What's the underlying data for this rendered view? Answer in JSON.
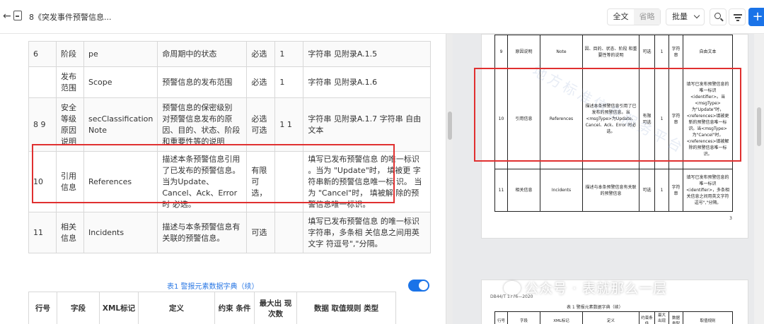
{
  "toolbar": {
    "back": "←",
    "doc_title": "8《突发事件预警信息...",
    "view_full": "全文",
    "view_brief": "省略",
    "batch": "批量",
    "add": "+"
  },
  "left_table": {
    "rows": [
      {
        "no": "6",
        "name": "阶段",
        "xml": "pe",
        "def": "命周期中的状态",
        "req": "必选",
        "count": "1",
        "type": "字符串 见附录A.1.5"
      },
      {
        "no": "",
        "name": "发布范围",
        "xml": "Scope",
        "def": "预警信息的发布范围",
        "req": "必选",
        "count": "1",
        "type": "字符串 见附录A.1.6"
      },
      {
        "no": "8 9",
        "name": "安全等级 原因说明",
        "xml": "secClassification Note",
        "def": "预警信息的保密级别 对预警信息发布的原 因、目的、状态、阶段 和重要性等的说明",
        "req": "必选 可选",
        "count": "1 1",
        "type": "字符串 见附录A.1.7 字符串 自由文本"
      },
      {
        "no": "10",
        "name": "引用信息",
        "xml": "References",
        "def": "描述本条预警信息引用了已发布的预警信息。当为Update、Cancel、Ack、Error 时 必选。",
        "req": "有限可选，",
        "count": "",
        "type": "填写已发布预警信息 的唯一标识 。当为 \"Update\"时， 填被更 字符串新的预警信息唯一标 识。 当为 \"Cancel\"时， 填被解 除的预警信息唯一标识。"
      },
      {
        "no": "11",
        "name": "相关信息",
        "xml": "Incidents",
        "def": "描述与本条预警信息有关联的预警信息。",
        "req": "可选",
        "count": "",
        "type": "填写已发布预警信息 的唯一标识 字符串，多条相 关信息之间用英文字 符逗号\",\"分隔。"
      }
    ],
    "caption": "表1 警报元素数据字典（续）",
    "header2": [
      "行号",
      "字段",
      "XML标记",
      "定义",
      "约束 条件",
      "最大出 现次数",
      "数据 取值规则 类型"
    ]
  },
  "right_page": {
    "watermark_text": "地方标准信息服务平台",
    "rows": [
      {
        "no": "9",
        "name": "原因说明",
        "xml": "Note",
        "def": "因、目的、状态、阶段 和重要性等的说明",
        "req": "可选",
        "count": "1",
        "dtype": "字符串",
        "rule": "自由文本"
      },
      {
        "no": "10",
        "name": "引用信息",
        "xml": "References",
        "def": "描述本条预警信息引用了已发布的预警信息。当<msgType>为Update、Cancel、Ack、Error 时必选。",
        "req": "有限可选",
        "count": "1",
        "dtype": "字符串",
        "rule": "填写已发布预警信息的唯一标识<identifier>。当<msgType>为\"Update\"时，<references>填被更新的预警信息唯一标识。当<msgType>为\"Cancel\"时，<references>填被解除的预警信息唯一标识。"
      },
      {
        "no": "11",
        "name": "相关信息",
        "xml": "Incidents",
        "def": "描述与本条预警信息有关联的预警信息",
        "req": "可选",
        "count": "1",
        "dtype": "字符串",
        "rule": "填写已发布预警信息的唯一标识<identifier>，多条相关信息之间用英文字符逗号\",\"分隔。"
      }
    ],
    "page_number": "3",
    "page2_head": "DB44/T 1776—2020",
    "page2_caption": "表 1 警报元素数据字典（续）",
    "page2_header": [
      "行号",
      "字段",
      "XML标记",
      "定义",
      "约束条件",
      "最大出现次数",
      "数据类型",
      "取值规则"
    ],
    "footer_watermark": "公众号 · 表就那么一层"
  },
  "colors": {
    "accent": "#1a73e8",
    "highlight_box": "#e03030",
    "caption": "#2b78e4"
  }
}
